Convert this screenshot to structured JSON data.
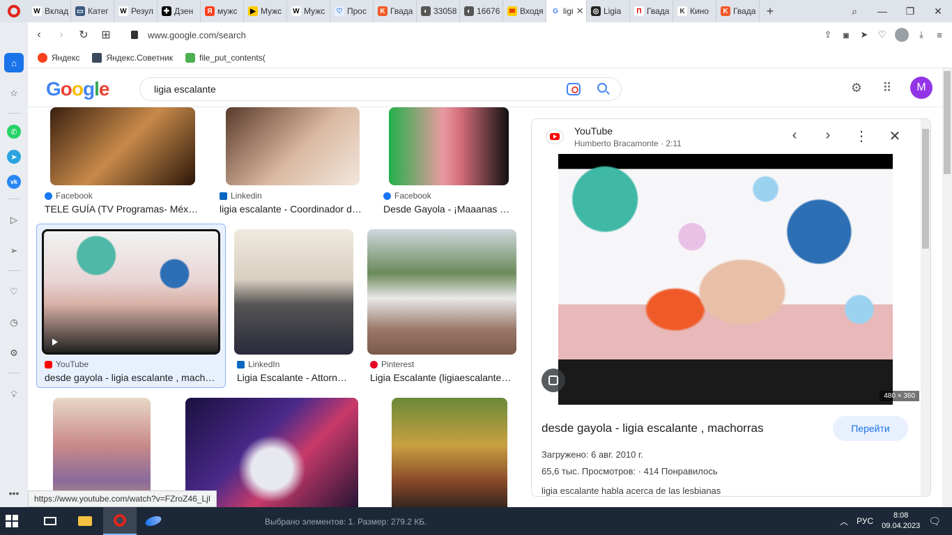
{
  "browser": {
    "tabs": [
      {
        "label": "Вклад",
        "fav": "W",
        "color": "#ffffff",
        "fg": "#000"
      },
      {
        "label": "Катег",
        "fav": "▭",
        "color": "#3d5a80",
        "fg": "#fff"
      },
      {
        "label": "Резул",
        "fav": "W",
        "color": "#ffffff",
        "fg": "#000"
      },
      {
        "label": "Дзен",
        "fav": "✚",
        "color": "#000000",
        "fg": "#fff"
      },
      {
        "label": "мужс",
        "fav": "Я",
        "color": "#fc3f1d",
        "fg": "#fff"
      },
      {
        "label": "Мужс",
        "fav": "▶",
        "color": "#ffcc00",
        "fg": "#000"
      },
      {
        "label": "Мужс",
        "fav": "W",
        "color": "#ffffff",
        "fg": "#000"
      },
      {
        "label": "Прос",
        "fav": "♡",
        "color": "#e8f0fe",
        "fg": "#1a73e8"
      },
      {
        "label": "Гвада",
        "fav": "K",
        "color": "#f05a28",
        "fg": "#fff"
      },
      {
        "label": "33058",
        "fav": "◐",
        "color": "#555555",
        "fg": "#fff"
      },
      {
        "label": "16676",
        "fav": "◐",
        "color": "#555555",
        "fg": "#fff"
      },
      {
        "label": "Входя",
        "fav": "✉",
        "color": "#ffcc00",
        "fg": "#d00"
      },
      {
        "label": "ligi",
        "fav": "G",
        "color": "#ffffff",
        "fg": "#4285f4"
      },
      {
        "label": "Ligia",
        "fav": "◎",
        "color": "#222222",
        "fg": "#fff"
      },
      {
        "label": "Гвада",
        "fav": "П",
        "color": "#ffffff",
        "fg": "#d00"
      },
      {
        "label": "Кино",
        "fav": "K",
        "color": "#ffffff",
        "fg": "#333"
      },
      {
        "label": "Гвада",
        "fav": "K",
        "color": "#f05a28",
        "fg": "#fff"
      }
    ],
    "active_tab_index": 12,
    "url": "www.google.com/search",
    "bookmarks": [
      "Яндекс",
      "Яндекс.Советник",
      "file_put_contents("
    ],
    "status_url": "https://www.youtube.com/watch?v=FZroZ46_LjI"
  },
  "google": {
    "query": "ligia escalante",
    "avatar_letter": "M"
  },
  "results": [
    {
      "source": "Facebook",
      "source_color": "#1877f2",
      "title": "TELE GUÍA (TV Programas- Méx…"
    },
    {
      "source": "Linkedin",
      "source_color": "#0a66c2",
      "title": "ligia escalante - Coordinador d…"
    },
    {
      "source": "Facebook",
      "source_color": "#1877f2",
      "title": "Desde Gayola - ¡Maaanas …"
    },
    {
      "source": "YouTube",
      "source_color": "#ff0000",
      "title": "desde gayola - ligia escalante , mach…"
    },
    {
      "source": "LinkedIn",
      "source_color": "#0a66c2",
      "title": "Ligia Escalante - Attorn…"
    },
    {
      "source": "Pinterest",
      "source_color": "#e60023",
      "title": "Ligia Escalante (ligiaescalante…"
    }
  ],
  "panel": {
    "source": "YouTube",
    "channel_duration": "Humberto Bracamonte · 2:11",
    "dimensions": "480 × 360",
    "title": "desde gayola - ligia escalante , machorras",
    "visit_label": "Перейти",
    "uploaded": "Загружено: 6 авг. 2010 г.",
    "stats": "65,6 тыс. Просмотров:  ·  414 Понравилось",
    "description": "ligia escalante habla acerca de las lesbianas"
  },
  "taskbar": {
    "status": "Выбрано элементов: 1. Размер: 279.2 КБ.",
    "lang": "РУС",
    "time": "8:08",
    "date": "09.04.2023"
  }
}
